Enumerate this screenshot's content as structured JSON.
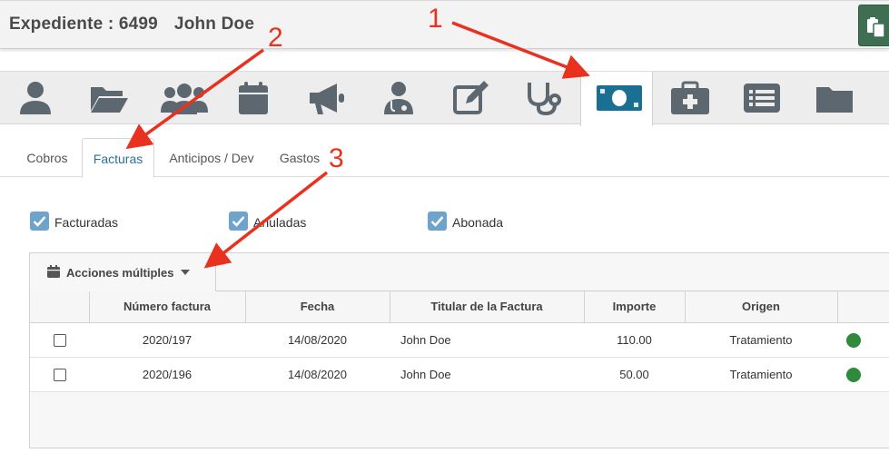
{
  "header": {
    "expediente_label": "Expediente : 6499",
    "patient_name": "John Doe",
    "action_icon": "clipboard-copy-icon"
  },
  "nav_icons": [
    {
      "name": "user-icon"
    },
    {
      "name": "folder-open-icon"
    },
    {
      "name": "users-icon"
    },
    {
      "name": "calendar-icon"
    },
    {
      "name": "megaphone-icon"
    },
    {
      "name": "doctor-icon"
    },
    {
      "name": "edit-icon"
    },
    {
      "name": "stethoscope-icon"
    },
    {
      "name": "money-bill-icon",
      "active": true
    },
    {
      "name": "medkit-icon"
    },
    {
      "name": "list-icon"
    },
    {
      "name": "folder-icon"
    }
  ],
  "tabs": [
    {
      "label": "Cobros"
    },
    {
      "label": "Facturas",
      "active": true
    },
    {
      "label": "Anticipos / Dev"
    },
    {
      "label": "Gastos"
    }
  ],
  "filters": [
    {
      "label": "Facturadas",
      "checked": true
    },
    {
      "label": "Anuladas",
      "checked": true
    },
    {
      "label": "Abonada",
      "checked": true
    }
  ],
  "toolbar": {
    "actions_label": "Acciones múltiples"
  },
  "table": {
    "columns": [
      "",
      "Número factura",
      "Fecha",
      "Titular de la Factura",
      "Importe",
      "Origen",
      ""
    ],
    "rows": [
      {
        "numero": "2020/197",
        "fecha": "14/08/2020",
        "titular": "John Doe",
        "importe": "110.00",
        "origen": "Tratamiento",
        "status_color": "#2f8a3c"
      },
      {
        "numero": "2020/196",
        "fecha": "14/08/2020",
        "titular": "John Doe",
        "importe": "50.00",
        "origen": "Tratamiento",
        "status_color": "#2f8a3c"
      }
    ]
  },
  "annotations": [
    "1",
    "2",
    "3"
  ],
  "colors": {
    "accent": "#2f6f91",
    "active_icon": "#1b6f93",
    "nav_icon": "#5d6770",
    "checkbox": "#6ea3cb",
    "annotation": "#e8321f",
    "header_button": "#3f6e52"
  }
}
